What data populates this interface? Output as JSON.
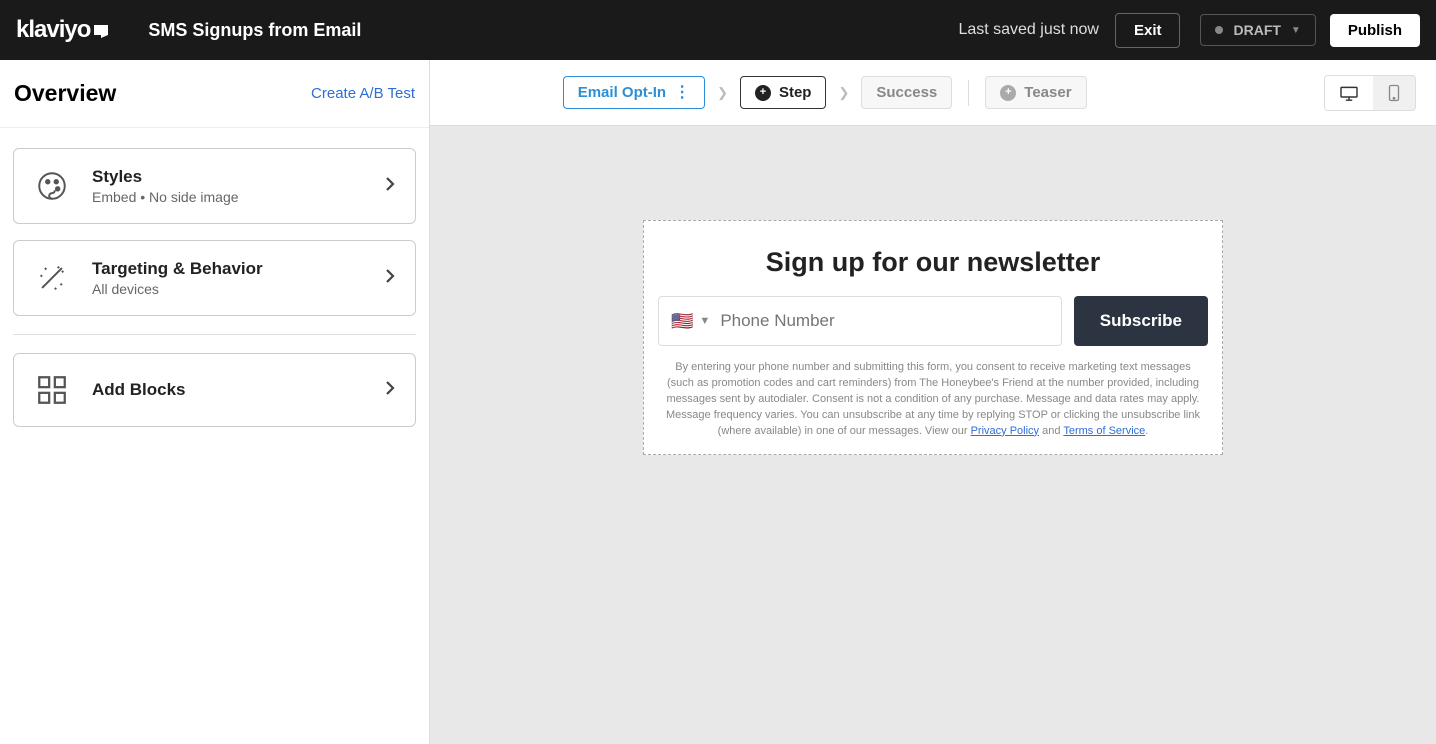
{
  "header": {
    "logo_text": "klaviyo",
    "title": "SMS Signups from Email",
    "last_saved": "Last saved just now",
    "exit": "Exit",
    "status": "DRAFT",
    "publish": "Publish"
  },
  "sidebar": {
    "overview": "Overview",
    "ab_link": "Create A/B Test",
    "cards": [
      {
        "title": "Styles",
        "sub": "Embed • No side image"
      },
      {
        "title": "Targeting & Behavior",
        "sub": "All devices"
      },
      {
        "title": "Add Blocks",
        "sub": ""
      }
    ]
  },
  "steps": {
    "email_opt": "Email Opt-In",
    "step": "Step",
    "success": "Success",
    "teaser": "Teaser"
  },
  "form": {
    "headline": "Sign up for our newsletter",
    "flag": "🇺🇸",
    "placeholder": "Phone Number",
    "subscribe": "Subscribe",
    "disclaimer_1": "By entering your phone number and submitting this form, you consent to receive marketing text messages (such as promotion codes and cart reminders) from The Honeybee's Friend at the number provided, including messages sent by autodialer. Consent is not a condition of any purchase. Message and data rates may apply. Message frequency varies. You can unsubscribe at any time by replying STOP or clicking the unsubscribe link (where available) in one of our messages. View our ",
    "privacy": "Privacy Policy",
    "and": " and ",
    "terms": "Terms of Service",
    "period": "."
  }
}
